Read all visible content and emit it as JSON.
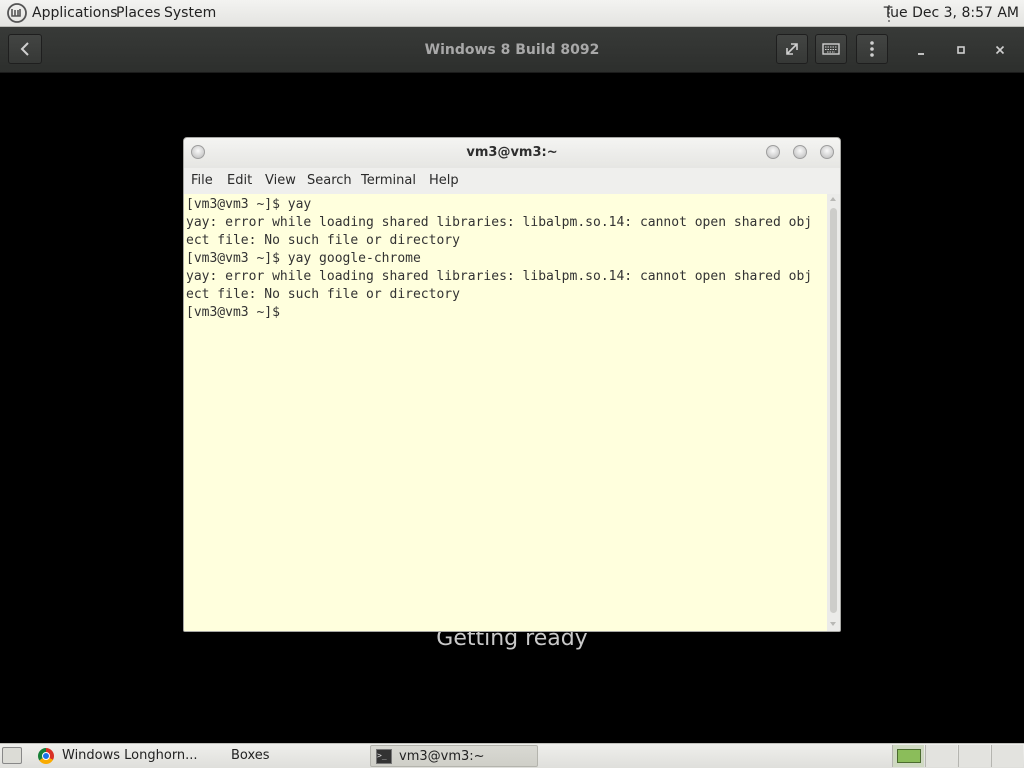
{
  "top_panel": {
    "menus": [
      "Applications",
      "Places",
      "System"
    ],
    "clock": "Tue Dec  3,  8:57 AM"
  },
  "boxes": {
    "title": "Windows 8 Build 8092",
    "status": "Getting ready"
  },
  "terminal": {
    "title": "vm3@vm3:~",
    "menu": [
      "File",
      "Edit",
      "View",
      "Search",
      "Terminal",
      "Help"
    ],
    "output": "[vm3@vm3 ~]$ yay\nyay: error while loading shared libraries: libalpm.so.14: cannot open shared obj\nect file: No such file or directory\n[vm3@vm3 ~]$ yay google-chrome\nyay: error while loading shared libraries: libalpm.so.14: cannot open shared obj\nect file: No such file or directory\n[vm3@vm3 ~]$"
  },
  "taskbar": {
    "tasks": [
      {
        "label": "Windows Longhorn...",
        "icon": "chrome-icon",
        "active": false
      },
      {
        "label": "Boxes",
        "icon": "",
        "active": false
      },
      {
        "label": "vm3@vm3:~",
        "icon": "terminal-icon",
        "active": true
      }
    ],
    "workspaces": 4,
    "active_workspace": 1
  },
  "colors": {
    "terminal_background": "#ffffdd",
    "vm_background": "#000000"
  }
}
